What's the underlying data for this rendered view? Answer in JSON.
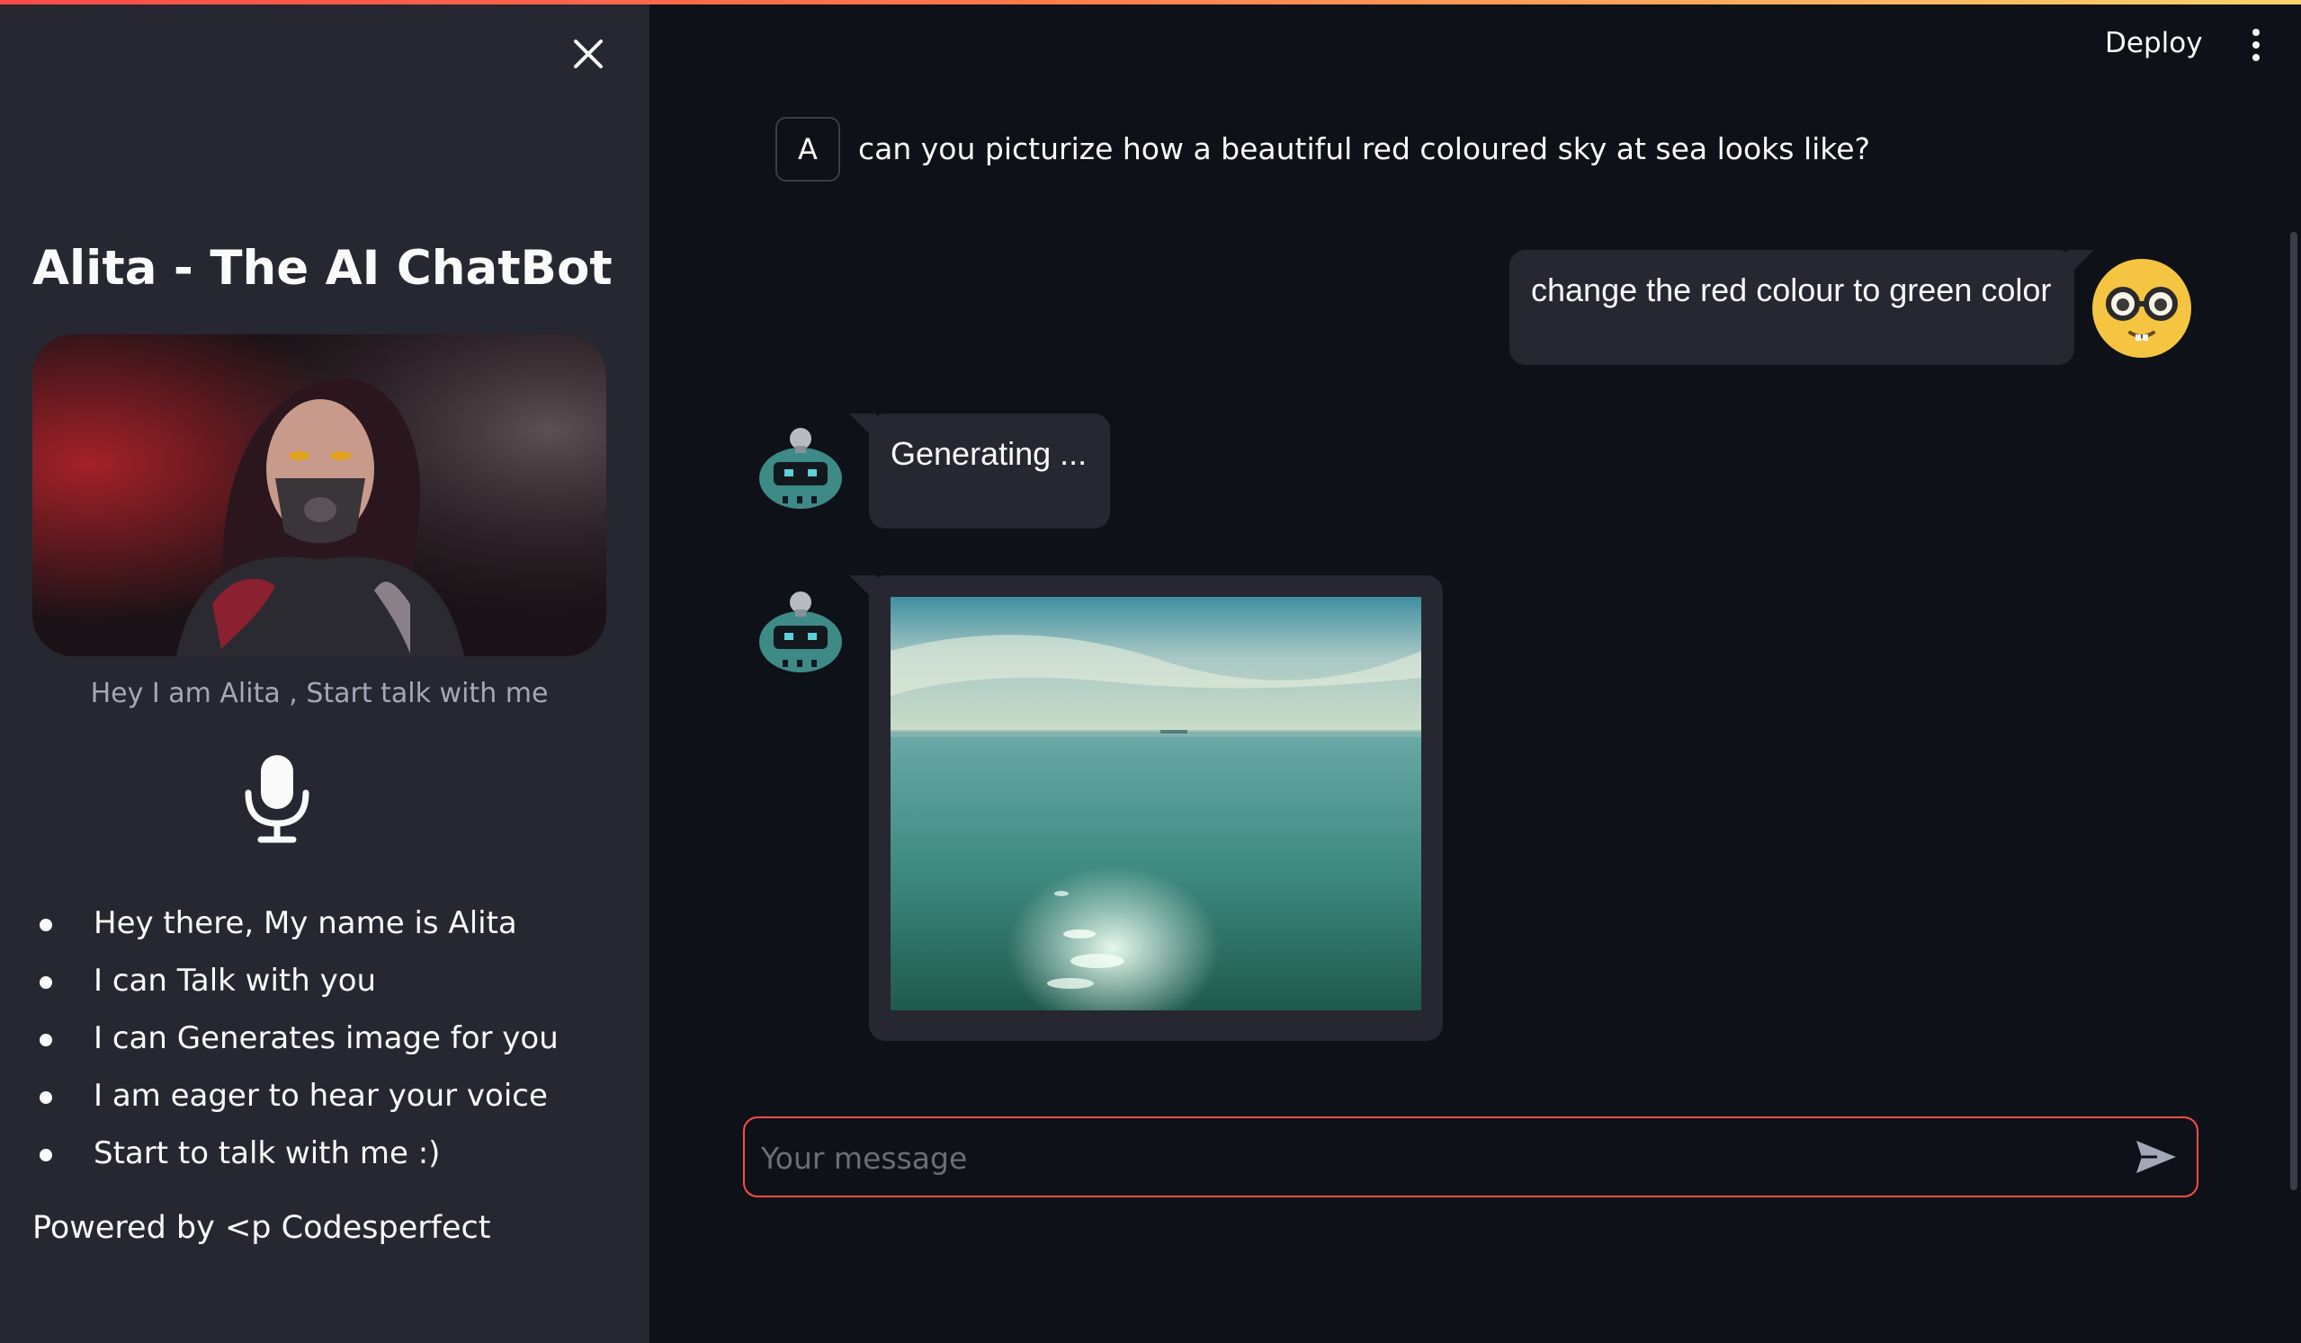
{
  "sidebar": {
    "title": "Alita - The AI ChatBot",
    "caption": "Hey I am Alita , Start talk with me",
    "bullets": [
      "Hey there, My name is Alita",
      "I can Talk with you",
      "I can Generates image for you",
      "I am eager to hear your voice",
      "Start to talk with me :)"
    ],
    "powered_by": "Powered by <p Codesperfect",
    "icons": {
      "close": "close-icon",
      "mic": "microphone-icon"
    }
  },
  "header": {
    "deploy_label": "Deploy",
    "menu_icon": "kebab-menu-icon"
  },
  "chat": {
    "messages": [
      {
        "role": "user",
        "avatar_letter": "A",
        "text": "can you picturize how a beautiful red coloured sky at sea looks like?"
      },
      {
        "role": "user",
        "avatar": "nerd-face-emoji",
        "text": "change the red colour to green color"
      },
      {
        "role": "assistant",
        "avatar": "robot-avatar",
        "text": "Generating ..."
      },
      {
        "role": "assistant",
        "avatar": "robot-avatar",
        "content": "generated-image-greenish-sea"
      }
    ]
  },
  "input": {
    "placeholder": "Your message",
    "value": "",
    "send_icon": "send-icon"
  },
  "colors": {
    "background": "#0e1117",
    "sidebar": "#262730",
    "bubble": "#262730",
    "accent": "#ff4b4b",
    "text": "#fafafa"
  }
}
